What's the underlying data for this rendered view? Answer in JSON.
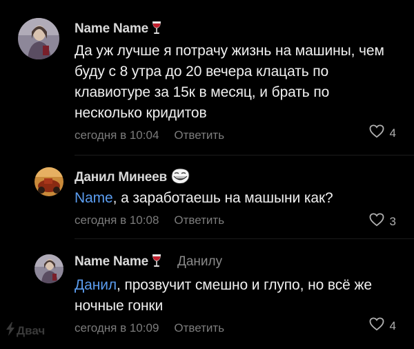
{
  "comments": [
    {
      "author": "Name Name",
      "author_emoji": "wine-glass-emoji",
      "text": "Да уж лучше я потрачу жизнь на машины, чем буду с 8 утра до 20 вечера клацать по клавиотуре за 15к в месяц, и брать по несколько кридитов",
      "time": "сегодня в 10:04",
      "reply_label": "Ответить",
      "likes": "4"
    },
    {
      "author": "Данил Минеев",
      "author_emoji": "trollface-emoji",
      "mention": "Name",
      "text": ", а заработаешь на машыни как?",
      "time": "сегодня в 10:08",
      "reply_label": "Ответить",
      "likes": "3"
    },
    {
      "author": "Name Name",
      "author_emoji": "wine-glass-emoji",
      "reply_to": "Данилу",
      "mention": "Данил",
      "text": ", прозвучит смешно и глупо, но всё же ночные гонки",
      "time": "сегодня в 10:09",
      "reply_label": "Ответить",
      "likes": "4"
    }
  ],
  "watermark": "Двач",
  "colors": {
    "background": "#000000",
    "mention": "#5b9df0",
    "meta": "#7c7c7c"
  }
}
